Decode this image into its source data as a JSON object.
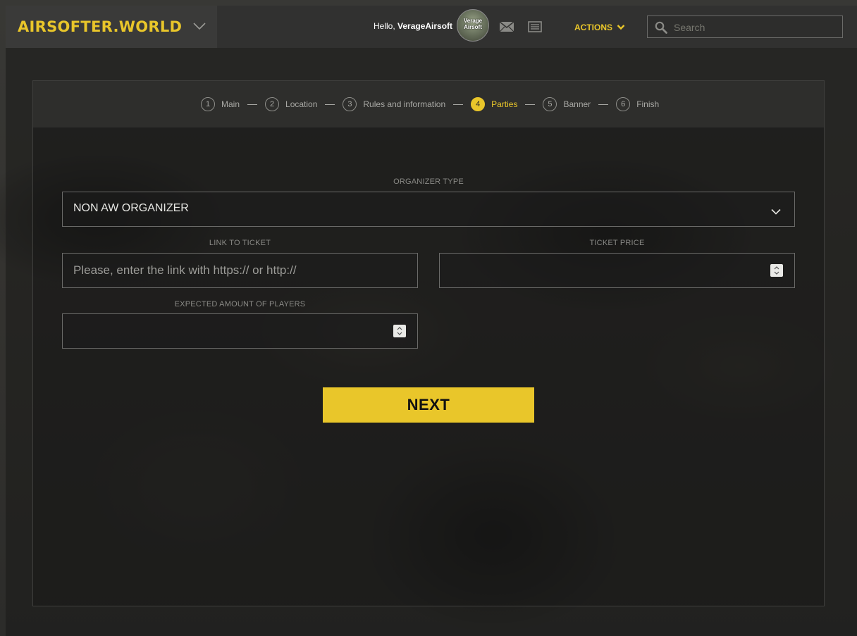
{
  "header": {
    "logo": "AIRSOFTER.WORLD",
    "greeting": "Hello, ",
    "username": "VerageAirsoft",
    "avatar_text": "Verage Airsoft",
    "actions_label": "ACTIONS",
    "search_placeholder": "Search"
  },
  "steps": [
    {
      "num": "1",
      "label": "Main"
    },
    {
      "num": "2",
      "label": "Location"
    },
    {
      "num": "3",
      "label": "Rules and information"
    },
    {
      "num": "4",
      "label": "Parties",
      "active": true
    },
    {
      "num": "5",
      "label": "Banner"
    },
    {
      "num": "6",
      "label": "Finish"
    }
  ],
  "form": {
    "organizer_type_label": "ORGANIZER TYPE",
    "organizer_type_value": "NON AW ORGANIZER",
    "link_label": "LINK TO TICKET",
    "link_placeholder": "Please, enter the link with https:// or http://",
    "price_label": "TICKET PRICE",
    "players_label": "EXPECTED AMOUNT OF PLAYERS",
    "next_label": "NEXT"
  },
  "colors": {
    "accent": "#e9c62a",
    "background": "#3b3b39",
    "header": "#313130"
  }
}
